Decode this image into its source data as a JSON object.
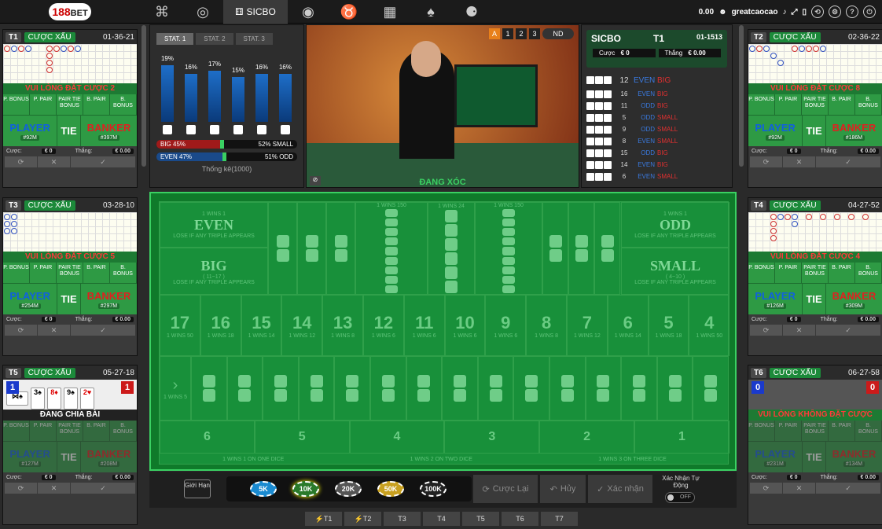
{
  "top": {
    "logo": "188",
    "logo_sub": "BET",
    "game_active": "SICBO",
    "balance": "0.00",
    "username": "greatcaocao"
  },
  "panels": {
    "t1": {
      "id": "T1",
      "road": "CƯỢC XẤU",
      "code": "01-36-21",
      "msg": "VUI LÒNG ĐẶT CƯỢC 2",
      "player_amt": "#92M",
      "banker_amt": "#397M",
      "stake": "€ 0",
      "win": "€ 0.00"
    },
    "t3": {
      "id": "T3",
      "road": "CƯỢC XẤU",
      "code": "03-28-10",
      "msg": "VUI LÒNG ĐẶT CƯỢC 5",
      "player_amt": "#254M",
      "banker_amt": "#297M",
      "stake": "€ 0",
      "win": "€ 0.00"
    },
    "t5": {
      "id": "T5",
      "road": "CƯỢC XẤU",
      "code": "05-27-18",
      "msg": "ĐANG CHIA BÀI",
      "player_amt": "#127M",
      "banker_amt": "#208M",
      "stake": "€ 0",
      "win": "€ 0.00",
      "pscore": "1",
      "bscore": "1"
    },
    "t2": {
      "id": "T2",
      "road": "CƯỢC XẤU",
      "code": "02-36-22",
      "msg": "VUI LÒNG ĐẶT CƯỢC 8",
      "player_amt": "#92M",
      "banker_amt": "#186M",
      "stake": "€ 0",
      "win": "€ 0.00"
    },
    "t4": {
      "id": "T4",
      "road": "CƯỢC XẤU",
      "code": "04-27-52",
      "msg": "VUI LÒNG ĐẶT CƯỢC 4",
      "player_amt": "#126M",
      "banker_amt": "#309M",
      "stake": "€ 0",
      "win": "€ 0.00"
    },
    "t6": {
      "id": "T6",
      "road": "CƯỢC XẤU",
      "code": "06-27-58",
      "msg": "VUI LÒNG KHÔNG ĐẶT CƯỢC",
      "player_amt": "#231M",
      "banker_amt": "#134M",
      "stake": "€ 0",
      "win": "€ 0.00",
      "pscore": "0",
      "bscore": "0"
    }
  },
  "labels": {
    "pbonus": "P. BONUS",
    "ppair": "P. PAIR",
    "ptie": "PAIR TIE BONUS",
    "bpair": "B. PAIR",
    "bbonus": "B. BONUS",
    "player": "PLAYER",
    "tie": "TIE",
    "banker": "BANKER",
    "stake": "Cược:",
    "win": "Thắng:"
  },
  "stats": {
    "tabs": [
      "STAT. 1",
      "STAT. 2",
      "STAT. 3"
    ],
    "pcts": [
      "19%",
      "16%",
      "17%",
      "15%",
      "16%",
      "16%"
    ],
    "values": [
      19,
      16,
      17,
      15,
      16,
      16
    ],
    "big": "BIG 45%",
    "small": "52% SMALL",
    "even": "EVEN 47%",
    "odd": "51% ODD",
    "footer": "Thống kê(1000)"
  },
  "video": {
    "status": "ĐANG XÓC",
    "btns": [
      "A",
      "1",
      "2",
      "3"
    ],
    "nd": "ND"
  },
  "round": {
    "game": "SICBO",
    "table": "T1",
    "code": "01-1513",
    "bet_label": "Cược",
    "bet_val": "€ 0",
    "win_label": "Thắng",
    "win_val": "€ 0.00",
    "history": [
      {
        "n": "12",
        "eo": "EVEN",
        "bs": "BIG"
      },
      {
        "n": "16",
        "eo": "EVEN",
        "bs": "BIG"
      },
      {
        "n": "11",
        "eo": "ODD",
        "bs": "BIG"
      },
      {
        "n": "5",
        "eo": "ODD",
        "bs": "SMALL"
      },
      {
        "n": "9",
        "eo": "ODD",
        "bs": "SMALL"
      },
      {
        "n": "8",
        "eo": "EVEN",
        "bs": "SMALL"
      },
      {
        "n": "15",
        "eo": "ODD",
        "bs": "BIG"
      },
      {
        "n": "14",
        "eo": "EVEN",
        "bs": "BIG"
      },
      {
        "n": "6",
        "eo": "EVEN",
        "bs": "SMALL"
      }
    ]
  },
  "table": {
    "even": "EVEN",
    "odd": "ODD",
    "big": "BIG",
    "small": "SMALL",
    "big_range": "( 11~17 )",
    "small_range": "( 4~10 )",
    "lose": "LOSE IF ANY TRIPLE APPEARS",
    "w1": "1 WINS 1",
    "w8": "1 WINS 8",
    "w150": "1 WINS 150",
    "w24": "1 WINS 24",
    "w5": "1 WINS 5",
    "nums": [
      "17",
      "16",
      "15",
      "14",
      "13",
      "12",
      "11",
      "10",
      "9",
      "8",
      "7",
      "6",
      "5",
      "4"
    ],
    "payouts": [
      "1 WINS 50",
      "1 WINS 18",
      "1 WINS 14",
      "1 WINS 12",
      "1 WINS 8",
      "1 WINS 6",
      "1 WINS 6",
      "1 WINS 6",
      "1 WINS 6",
      "1 WINS 8",
      "1 WINS 12",
      "1 WINS 14",
      "1 WINS 18",
      "1 WINS 50"
    ],
    "singles": [
      "6",
      "5",
      "4",
      "3",
      "2",
      "1"
    ],
    "single_one": "1 WINS 1 ON ONE DICE",
    "single_two": "1 WINS 2 ON TWO DICE",
    "single_three": "1 WINS 3 ON THREE DICE"
  },
  "chipbar": {
    "limit": "Giới Hạn",
    "chips": [
      "5K",
      "10K",
      "20K",
      "50K",
      "100K"
    ],
    "repeat": "Cược Lại",
    "undo": "Hủy",
    "confirm": "Xác nhận",
    "auto": "Xác Nhận Tự Động",
    "toggle": "OFF"
  },
  "tabs": [
    "⚡T1",
    "⚡T2",
    "T3",
    "T4",
    "T5",
    "T6",
    "T7"
  ],
  "colors": {
    "felt": "#18903a",
    "accent": "#3ad062",
    "player": "#1060e0",
    "banker": "#e02020"
  }
}
